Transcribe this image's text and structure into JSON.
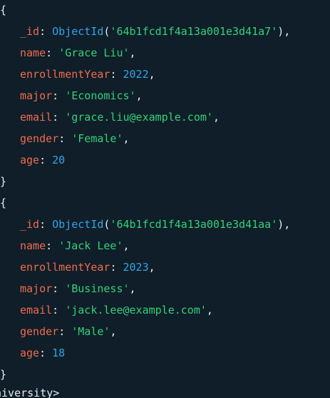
{
  "documents": [
    {
      "fields": [
        {
          "key": "_id",
          "fn": "ObjectId",
          "arg": "'64b1fcd1f4a13a001e3d41a7'",
          "type": "objectid"
        },
        {
          "key": "name",
          "value": "'Grace Liu'",
          "type": "string"
        },
        {
          "key": "enrollmentYear",
          "value": "2022",
          "type": "number"
        },
        {
          "key": "major",
          "value": "'Economics'",
          "type": "string"
        },
        {
          "key": "email",
          "value": "'grace.liu@example.com'",
          "type": "string"
        },
        {
          "key": "gender",
          "value": "'Female'",
          "type": "string"
        },
        {
          "key": "age",
          "value": "20",
          "type": "number"
        }
      ]
    },
    {
      "fields": [
        {
          "key": "_id",
          "fn": "ObjectId",
          "arg": "'64b1fcd1f4a13a001e3d41aa'",
          "type": "objectid"
        },
        {
          "key": "name",
          "value": "'Jack Lee'",
          "type": "string"
        },
        {
          "key": "enrollmentYear",
          "value": "2023",
          "type": "number"
        },
        {
          "key": "major",
          "value": "'Business'",
          "type": "string"
        },
        {
          "key": "email",
          "value": "'jack.lee@example.com'",
          "type": "string"
        },
        {
          "key": "gender",
          "value": "'Male'",
          "type": "string"
        },
        {
          "key": "age",
          "value": "18",
          "type": "number"
        }
      ]
    }
  ],
  "syntax": {
    "open_brace": "{",
    "close_brace": "}",
    "colon": ": ",
    "comma": ",",
    "paren_open": "(",
    "paren_close": ")"
  },
  "prompt": {
    "text": "niversity>"
  },
  "colors": {
    "background": "#0f1e28",
    "key": "#f06a4f",
    "string": "#33d17a",
    "number": "#33a3e8",
    "function": "#33a3e8",
    "text": "#e6ecef"
  }
}
